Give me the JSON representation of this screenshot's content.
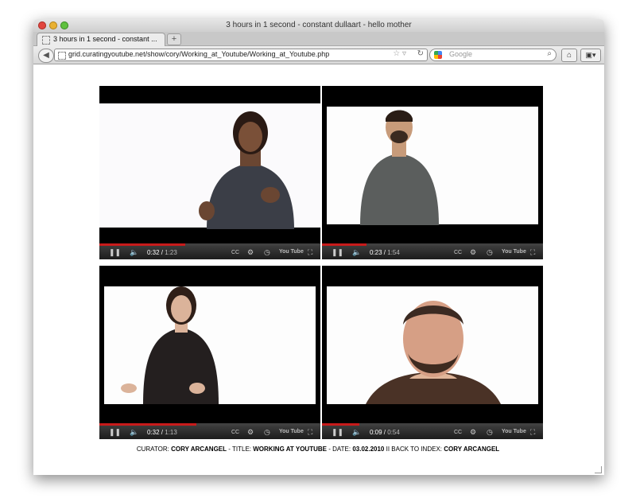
{
  "window": {
    "title": "3 hours in 1 second - constant dullaart - hello mother"
  },
  "tab": {
    "label": "3 hours in 1 second - constant ...",
    "new_tab_symbol": "+"
  },
  "navbar": {
    "url": "grid.curatingyoutube.net/show/cory/Working_at_Youtube/Working_at_Youtube.php",
    "search_placeholder": "Google",
    "back_icon": "back-arrow-icon",
    "home_icon": "home-icon"
  },
  "videos": [
    {
      "elapsed": "0:32",
      "duration": "1:23",
      "progress": 0.39
    },
    {
      "elapsed": "0:23",
      "duration": "1:54",
      "progress": 0.2
    },
    {
      "elapsed": "0:32",
      "duration": "1:13",
      "progress": 0.44
    },
    {
      "elapsed": "0:09",
      "duration": "0:54",
      "progress": 0.17
    }
  ],
  "player": {
    "logo_text": "You Tube"
  },
  "caption": {
    "curator_label": "CURATOR:",
    "curator": "CORY ARCANGEL",
    "title_label": "- TITLE:",
    "title": "WORKING AT YOUTUBE",
    "date_label": "- DATE:",
    "date": "03.02.2010",
    "back_label": "II BACK TO INDEX:",
    "back_link": "CORY ARCANGEL"
  }
}
